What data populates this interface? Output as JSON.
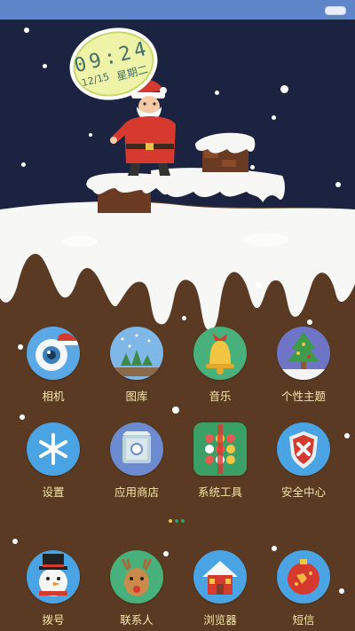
{
  "status_bar": {
    "battery_icon": "battery-icon"
  },
  "clock_widget": {
    "time": "09:24",
    "date": "12/15",
    "weekday": "星期二"
  },
  "theme": {
    "sky": "#1b2340",
    "ground": "#5a3a22",
    "snow": "#f7f7f5",
    "label_color": "#f4e7a6"
  },
  "apps": {
    "row1": [
      {
        "label": "相机",
        "icon": "camera-icon"
      },
      {
        "label": "图库",
        "icon": "gallery-icon"
      },
      {
        "label": "音乐",
        "icon": "music-bell-icon"
      },
      {
        "label": "个性主题",
        "icon": "theme-tree-icon"
      }
    ],
    "row2": [
      {
        "label": "设置",
        "icon": "settings-snowflake-icon"
      },
      {
        "label": "应用商店",
        "icon": "app-store-icon"
      },
      {
        "label": "系统工具",
        "icon": "system-tools-icon"
      },
      {
        "label": "安全中心",
        "icon": "security-shield-icon"
      }
    ]
  },
  "page_indicator": {
    "count": 3,
    "active_index": 0
  },
  "dock": [
    {
      "label": "拨号",
      "icon": "dialer-snowman-icon"
    },
    {
      "label": "联系人",
      "icon": "contacts-reindeer-icon"
    },
    {
      "label": "浏览器",
      "icon": "browser-house-icon"
    },
    {
      "label": "短信",
      "icon": "messages-ornament-icon"
    }
  ]
}
